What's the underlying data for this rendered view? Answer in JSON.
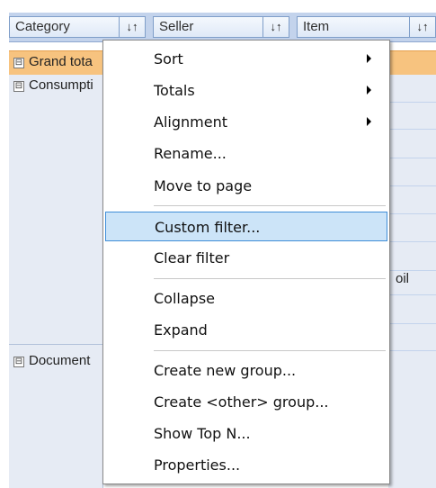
{
  "header": {
    "fields": [
      {
        "label": "Category",
        "sort_icon": "sort-ascending-icon",
        "sort_glyph": "↓↑"
      },
      {
        "label": "Seller",
        "sort_icon": "sort-ascending-icon",
        "sort_glyph": "↓↑"
      },
      {
        "label": "Item",
        "sort_icon": "sort-ascending-icon",
        "sort_glyph": "↓↑"
      }
    ]
  },
  "rows": {
    "grand_total": {
      "label": "Grand tota",
      "expander": "⊟",
      "color": "#f7c37f"
    },
    "groups": [
      {
        "label": "Consumpti",
        "expander": "⊟"
      },
      {
        "label": "Document",
        "expander": "⊟"
      }
    ],
    "visible_cell_text": "oil"
  },
  "context_menu": {
    "items": [
      {
        "label": "Sort",
        "submenu": true
      },
      {
        "label": "Totals",
        "submenu": true
      },
      {
        "label": "Alignment",
        "submenu": true
      },
      {
        "label": "Rename...",
        "submenu": false
      },
      {
        "label": "Move to page",
        "submenu": false
      },
      {
        "label": "Custom filter...",
        "submenu": false,
        "highlighted": true
      },
      {
        "label": "Clear filter",
        "submenu": false
      },
      {
        "label": "Collapse",
        "submenu": false
      },
      {
        "label": "Expand",
        "submenu": false
      },
      {
        "label": "Create new group...",
        "submenu": false
      },
      {
        "label": "Create <other> group...",
        "submenu": false
      },
      {
        "label": "Show Top N...",
        "submenu": false
      },
      {
        "label": "Properties...",
        "submenu": false
      }
    ]
  },
  "colors": {
    "header_background": "#c3d3ec",
    "grand_total_background": "#f7c37f",
    "menu_highlight": "#cce4f8",
    "menu_highlight_border": "#3f8ed8",
    "grid_background": "#e6ebf4"
  }
}
